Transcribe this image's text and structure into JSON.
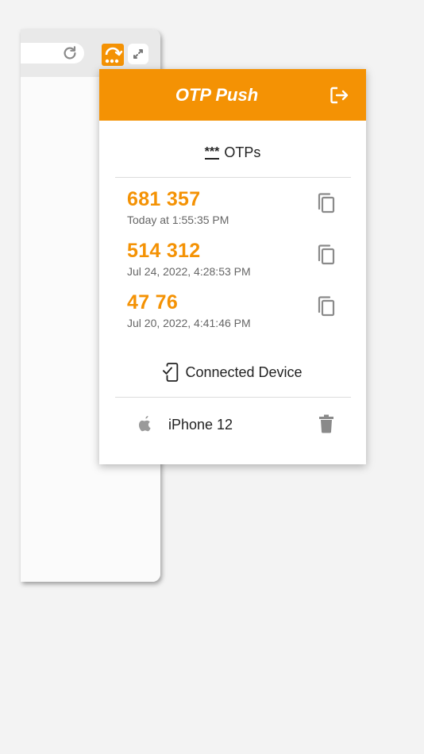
{
  "popup": {
    "title": "OTP Push",
    "header_color": "#f49204",
    "otps_section": {
      "icon": "password-stars-icon",
      "stars": "***",
      "label": "OTPs"
    },
    "otps": [
      {
        "code": "681 357",
        "time": "Today at 1:55:35 PM"
      },
      {
        "code": "514 312",
        "time": "Jul 24, 2022, 4:28:53 PM"
      },
      {
        "code": "47 76",
        "time": "Jul 20, 2022, 4:41:46 PM"
      }
    ],
    "device_section": {
      "icon": "phone-check-icon",
      "label": "Connected Device"
    },
    "device": {
      "icon": "apple-icon",
      "name": "iPhone 12"
    }
  },
  "browser": {
    "icons": [
      "reload-icon",
      "otp-push-extension-icon",
      "expand-icon"
    ]
  }
}
